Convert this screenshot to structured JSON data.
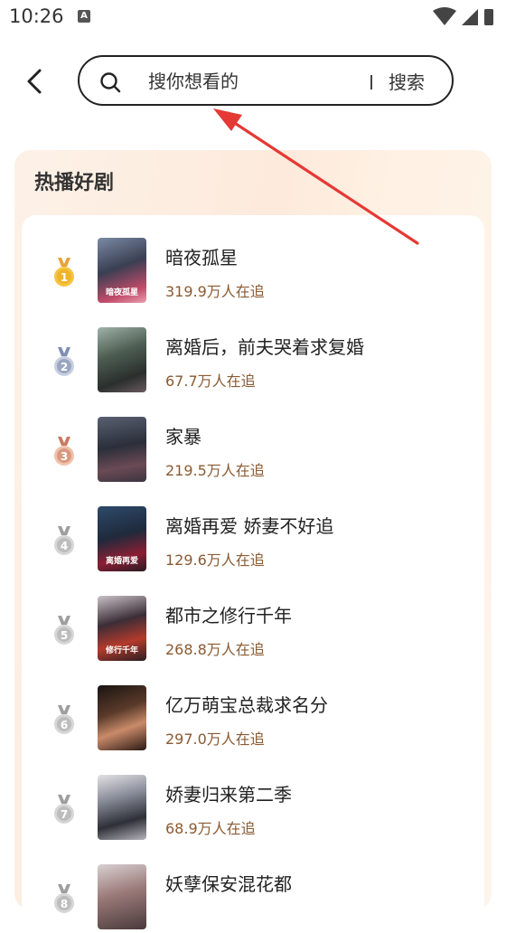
{
  "status_bar": {
    "time": "10:26",
    "notification_badge": "A"
  },
  "search": {
    "placeholder": "搜你想看的",
    "button_label": "搜索"
  },
  "section": {
    "title": "热播好剧"
  },
  "colors": {
    "accent_brown": "#8a5a32",
    "gold": "#f0b429",
    "silver": "#9aa6bf",
    "bronze": "#d99a80",
    "gray_badge": "#bdbdbd",
    "annotation_red": "#e53935"
  },
  "shows": [
    {
      "rank": "1",
      "title": "暗夜孤星",
      "views": "319.9万人在追",
      "poster_caption": "暗夜孤星"
    },
    {
      "rank": "2",
      "title": "离婚后，前夫哭着求复婚",
      "views": "67.7万人在追",
      "poster_caption": ""
    },
    {
      "rank": "3",
      "title": "家暴",
      "views": "219.5万人在追",
      "poster_caption": ""
    },
    {
      "rank": "4",
      "title": "离婚再爱 娇妻不好追",
      "views": "129.6万人在追",
      "poster_caption": "离婚再爱"
    },
    {
      "rank": "5",
      "title": "都市之修行千年",
      "views": "268.8万人在追",
      "poster_caption": "修行千年"
    },
    {
      "rank": "6",
      "title": "亿万萌宝总裁求名分",
      "views": "297.0万人在追",
      "poster_caption": ""
    },
    {
      "rank": "7",
      "title": "娇妻归来第二季",
      "views": "68.9万人在追",
      "poster_caption": ""
    },
    {
      "rank": "8",
      "title": "妖孽保安混花都",
      "views": "",
      "poster_caption": ""
    }
  ]
}
